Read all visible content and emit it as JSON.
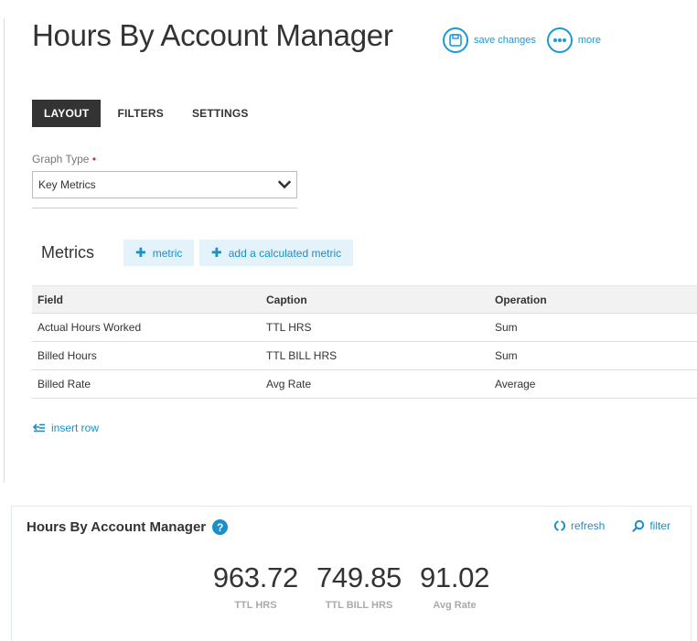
{
  "page": {
    "title": "Hours By Account Manager",
    "actions": [
      {
        "label": "save changes",
        "icon": "save-icon"
      },
      {
        "label": "more",
        "icon": "more-icon"
      }
    ]
  },
  "tabs": [
    "LAYOUT",
    "FILTERS",
    "SETTINGS"
  ],
  "active_tab": "LAYOUT",
  "graph_type": {
    "label": "Graph Type",
    "required_marker": "•",
    "value": "Key Metrics"
  },
  "metrics": {
    "title": "Metrics",
    "add_metric_label": "metric",
    "add_calc_label": "add a calculated metric",
    "columns": [
      "Field",
      "Caption",
      "Operation"
    ],
    "rows": [
      [
        "Actual Hours Worked",
        "TTL HRS",
        "Sum"
      ],
      [
        "Billed Hours",
        "TTL BILL HRS",
        "Sum"
      ],
      [
        "Billed Rate",
        "Avg Rate",
        "Average"
      ]
    ],
    "insert_row_label": "insert row"
  },
  "widget": {
    "title": "Hours By Account Manager",
    "help_glyph": "?",
    "refresh_label": "refresh",
    "filter_label": "filter",
    "stats": [
      {
        "value": "963.72",
        "caption": "TTL HRS"
      },
      {
        "value": "749.85",
        "caption": "TTL BILL HRS"
      },
      {
        "value": "91.02",
        "caption": "Avg Rate"
      }
    ]
  },
  "colors": {
    "accent": "#1a9ad6",
    "dark_tab": "#333333",
    "pill_bg": "#e4f2fa"
  }
}
